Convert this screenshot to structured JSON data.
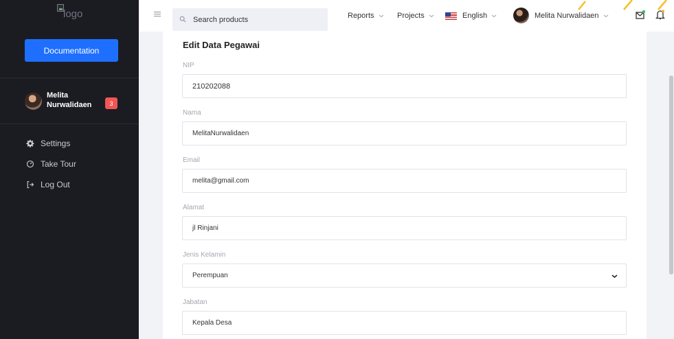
{
  "sidebar": {
    "logo_alt": "logo",
    "doc_button": "Documentation",
    "user": {
      "name": "Melita Nurwalidaen",
      "badge": "3"
    },
    "items": [
      {
        "label": "Settings",
        "icon": "gear-icon"
      },
      {
        "label": "Take Tour",
        "icon": "gauge-icon"
      },
      {
        "label": "Log Out",
        "icon": "logout-icon"
      }
    ]
  },
  "topbar": {
    "search_placeholder": "Search products",
    "menus": [
      "Reports",
      "Projects"
    ],
    "language": "English",
    "user_name": "Melita Nurwalidaen"
  },
  "form": {
    "title": "Edit Data Pegawai",
    "fields": [
      {
        "label": "NIP",
        "value": "210202088"
      },
      {
        "label": "Nama",
        "value": "MelitaNurwalidaen"
      },
      {
        "label": "Email",
        "value": "melita@gmail.com"
      },
      {
        "label": "Alamat",
        "value": "jl Rinjani"
      },
      {
        "label": "Jenis Kelamin",
        "value": "Perempuan"
      },
      {
        "label": "Jabatan",
        "value": "Kepala Desa"
      }
    ]
  },
  "colors": {
    "sidebar_bg": "#1b1c22",
    "primary": "#1f6fff",
    "badge": "#f25555",
    "accent_deco": "#f5c022"
  }
}
